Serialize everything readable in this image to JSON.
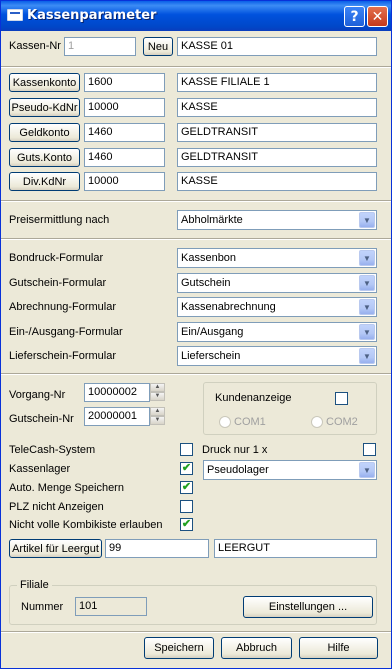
{
  "window": {
    "title": "Kassenparameter",
    "help_glyph": "?",
    "close_glyph": "✕"
  },
  "kasse": {
    "label": "Kassen-Nr",
    "number": "1",
    "new_button": "Neu",
    "name": "KASSE 01"
  },
  "accounts": [
    {
      "button": "Kassenkonto",
      "number": "1600",
      "name": "KASSE FILIALE 1"
    },
    {
      "button": "Pseudo-KdNr",
      "number": "10000",
      "name": "KASSE"
    },
    {
      "button": "Geldkonto",
      "number": "1460",
      "name": "GELDTRANSIT"
    },
    {
      "button": "Guts.Konto",
      "number": "1460",
      "name": "GELDTRANSIT"
    },
    {
      "button": "Div.KdNr",
      "number": "10000",
      "name": "KASSE"
    }
  ],
  "pricing": {
    "label": "Preisermittlung nach",
    "value": "Abholmärkte"
  },
  "forms": [
    {
      "label": "Bondruck-Formular",
      "value": "Kassenbon"
    },
    {
      "label": "Gutschein-Formular",
      "value": "Gutschein"
    },
    {
      "label": "Abrechnung-Formular",
      "value": "Kassenabrechnung"
    },
    {
      "label": "Ein-/Ausgang-Formular",
      "value": "Ein/Ausgang"
    },
    {
      "label": "Lieferschein-Formular",
      "value": "Lieferschein"
    }
  ],
  "numbers": {
    "vorgang_label": "Vorgang-Nr",
    "vorgang_value": "10000002",
    "gutschein_label": "Gutschein-Nr",
    "gutschein_value": "20000001"
  },
  "display": {
    "label": "Kundenanzeige",
    "checked": false,
    "com1": "COM1",
    "com2": "COM2"
  },
  "options": [
    {
      "label": "TeleCash-System",
      "checked": false
    },
    {
      "label": "Kassenlager",
      "checked": true
    },
    {
      "label": "Auto. Menge Speichern",
      "checked": true
    },
    {
      "label": "PLZ nicht Anzeigen",
      "checked": false
    },
    {
      "label": "Nicht volle Kombikiste erlauben",
      "checked": true
    }
  ],
  "druck": {
    "label": "Druck nur 1 x",
    "checked": false
  },
  "lager": {
    "value": "Pseudolager"
  },
  "leergut": {
    "button": "Artikel für Leergut",
    "number": "99",
    "name": "LEERGUT"
  },
  "filiale": {
    "group_label": "Filiale",
    "number_label": "Nummer",
    "number_value": "101",
    "settings_button": "Einstellungen ..."
  },
  "footer": {
    "save": "Speichern",
    "cancel": "Abbruch",
    "help": "Hilfe"
  },
  "glyphs": {
    "arrow_down": "▼",
    "spin_up": "▲",
    "spin_down": "▼",
    "check": "✔"
  },
  "colors": {
    "titlebar": "#0054e3",
    "window_bg": "#ece9d8",
    "checkmark": "#21a121"
  }
}
